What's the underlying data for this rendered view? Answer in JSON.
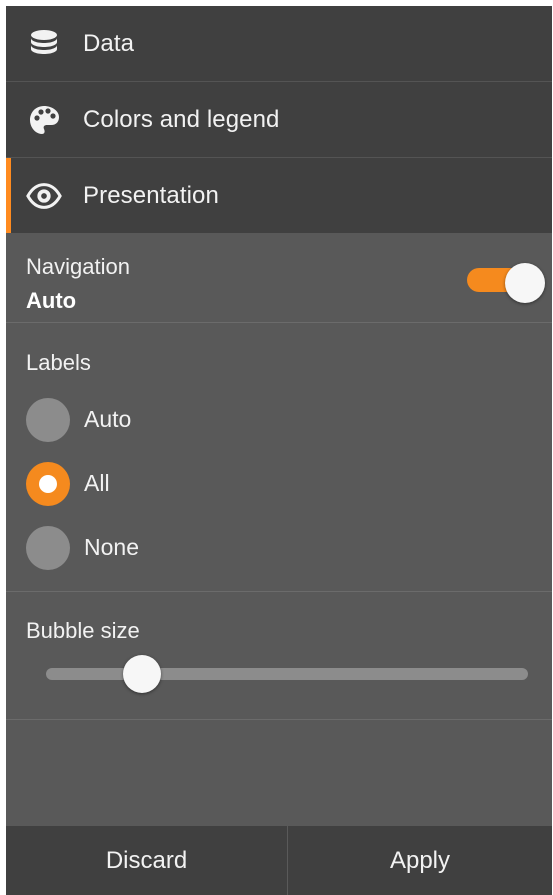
{
  "sections": [
    {
      "label": "Data",
      "icon": "database-icon"
    },
    {
      "label": "Colors and legend",
      "icon": "palette-icon"
    },
    {
      "label": "Presentation",
      "icon": "eye-icon",
      "active": true
    }
  ],
  "navigation": {
    "title": "Navigation",
    "value": "Auto",
    "toggle_on": true
  },
  "labels": {
    "title": "Labels",
    "options": [
      {
        "label": "Auto",
        "checked": false
      },
      {
        "label": "All",
        "checked": true
      },
      {
        "label": "None",
        "checked": false
      }
    ]
  },
  "bubble_size": {
    "title": "Bubble size",
    "value_fraction": 0.2
  },
  "footer": {
    "discard_label": "Discard",
    "apply_label": "Apply"
  },
  "colors": {
    "accent": "#f58a1e",
    "panel": "#595959",
    "header": "#404040"
  }
}
